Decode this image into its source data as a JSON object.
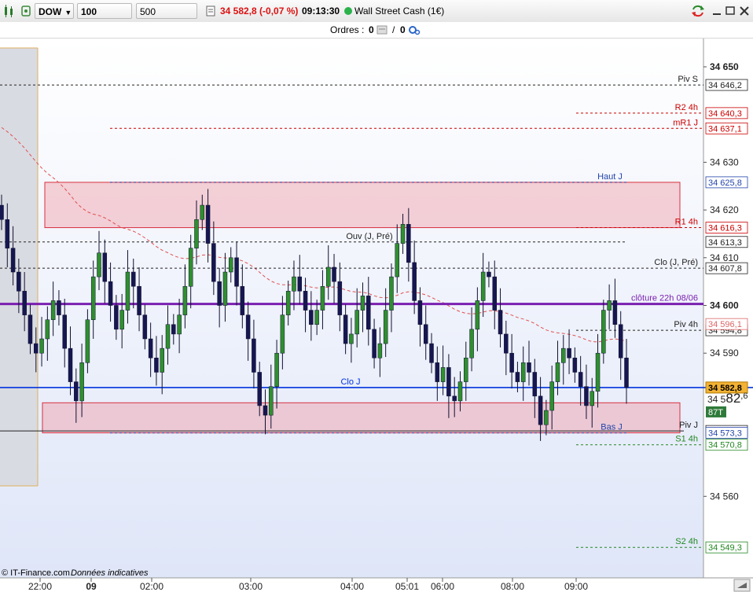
{
  "toolbar": {
    "symbol": "DOW",
    "ticks": "100 ticks",
    "units": "500 unités",
    "price_change": "34 582,8 (-0,07 %)",
    "time": "09:13:30",
    "instrument": "Wall Street Cash (1€)"
  },
  "orders": {
    "label": "Ordres :",
    "count_a": "0",
    "count_b": "0"
  },
  "footer": {
    "copyright": "© IT-Finance.com",
    "note": "Données indicatives"
  },
  "colors": {
    "up_candle": "#2f8f2f",
    "down_candle": "#161650",
    "accent": "#7a1fb0",
    "current_price": "#0033dd",
    "resistance": "#cc0000",
    "support": "#228822"
  },
  "chart_data": {
    "type": "candlestick",
    "instrument": "Wall Street Cash (1€)",
    "interval": "100 ticks",
    "ylim": [
      34545,
      34652
    ],
    "y_ticks": [
      "34 650",
      "34 630",
      "34 620",
      "34 610",
      "34 600",
      "34 590",
      "34 560"
    ],
    "x_ticks": [
      "22:00",
      "09",
      "02:00",
      "03:00",
      "04:00",
      "05:01",
      "06:00",
      "08:00",
      "09:00"
    ],
    "last_price": 34582.8,
    "last_price_badge": "34 582,8",
    "big_price": {
      "prefix": "34 5",
      "big": "82",
      "small": ",6"
    },
    "volume_badge": "87T",
    "close_series": [
      34618,
      34612,
      34607,
      34603,
      34598,
      34592,
      34590,
      34593,
      34597,
      34601,
      34598,
      34591,
      34584,
      34580,
      34588,
      34597,
      34606,
      34611,
      34605,
      34600,
      34595,
      34599,
      34607,
      34604,
      34598,
      34593,
      34589,
      34586,
      34591,
      34596,
      34594,
      34598,
      34604,
      34612,
      34618,
      34621,
      34613,
      34605,
      34600,
      34607,
      34610,
      34604,
      34598,
      34593,
      34586,
      34579,
      34577,
      34583,
      34590,
      34598,
      34603,
      34606,
      34603,
      34599,
      34596,
      34599,
      34604,
      34608,
      34605,
      34598,
      34592,
      34594,
      34599,
      34602,
      34595,
      34589,
      34592,
      34599,
      34606,
      34613,
      34617,
      34609,
      34601,
      34596,
      34592,
      34588,
      34584,
      34587,
      34581,
      34580,
      34584,
      34589,
      34595,
      34601,
      34607,
      34606,
      34599,
      34594,
      34590,
      34586,
      34584,
      34588,
      34586,
      34581,
      34575,
      34578,
      34584,
      34588,
      34591,
      34589,
      34586,
      34583,
      34579,
      34582,
      34590,
      34599,
      34601,
      34596,
      34589,
      34582.8
    ],
    "zones": [
      {
        "from": 34616.3,
        "to": 34625.8,
        "color": "#f08c96"
      },
      {
        "from": 34573.3,
        "to": 34579.6,
        "color": "#f08c96"
      }
    ],
    "levels": [
      {
        "name": "Piv S",
        "value": 34646.2,
        "badge": "34 646,2",
        "color": "#222222"
      },
      {
        "name": "R2 4h",
        "value": 34640.3,
        "badge": "34 640,3",
        "color": "#cc0000"
      },
      {
        "name": "mR1 J",
        "value": 34637.1,
        "badge": "34 637,1",
        "color": "#cc0000"
      },
      {
        "name": "Haut J",
        "value": 34625.8,
        "badge": "34 625,8",
        "color": "#2244aa"
      },
      {
        "name": "R1 4h",
        "value": 34616.3,
        "badge": "34 616,3",
        "color": "#cc0000"
      },
      {
        "name": "Ouv (J, Pré)",
        "value": 34613.3,
        "badge": "34 613,3",
        "color": "#222222"
      },
      {
        "name": "Clo (J, Pré)",
        "value": 34607.8,
        "badge": "34 607,8",
        "color": "#222222"
      },
      {
        "name": "clôture 22h 08/06",
        "value": 34600.3,
        "badge": "",
        "color": "#7a1fb0"
      },
      {
        "name": "Piv 4h",
        "value": 34594.8,
        "badge": "34 594,8",
        "color": "#222222"
      },
      {
        "name": "",
        "value": 34596.1,
        "badge": "34 596,1",
        "color": "#dd6666"
      },
      {
        "name": "Clo J",
        "value": 34582.8,
        "badge": "",
        "color": "#0033dd"
      },
      {
        "name": "Piv J",
        "value": 34573.7,
        "badge": "34 573,7",
        "color": "#222222"
      },
      {
        "name": "Bas J",
        "value": 34573.3,
        "badge": "34 573,3",
        "color": "#2244aa"
      },
      {
        "name": "S1 4h",
        "value": 34570.8,
        "badge": "34 570,8",
        "color": "#228822"
      },
      {
        "name": "S2 4h",
        "value": 34549.3,
        "badge": "34 549,3",
        "color": "#228822"
      }
    ]
  }
}
